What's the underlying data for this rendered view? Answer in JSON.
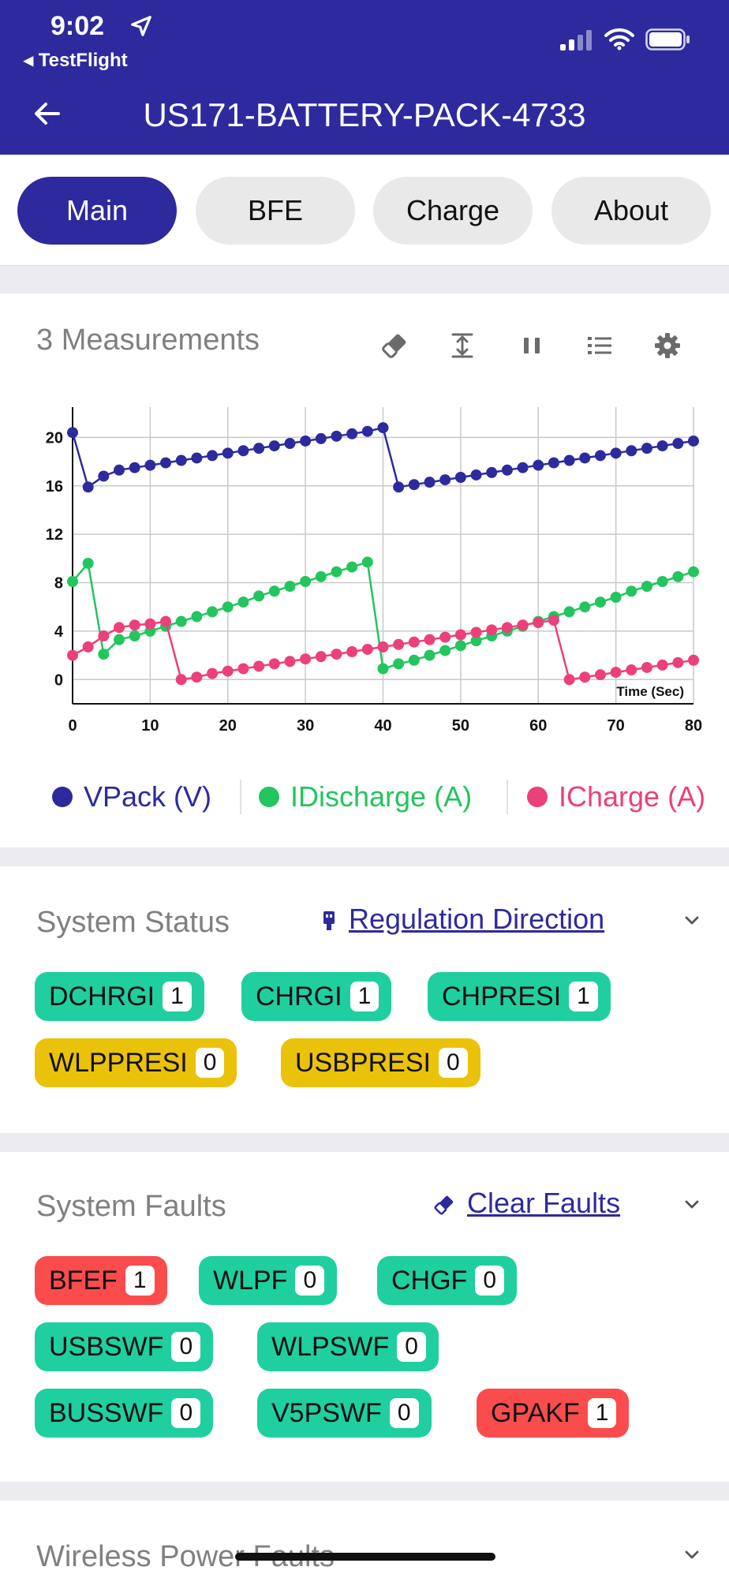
{
  "status_bar": {
    "time": "9:02",
    "back_app": "TestFlight"
  },
  "nav": {
    "title": "US171-BATTERY-PACK-4733"
  },
  "tabs": [
    {
      "label": "Main",
      "active": true
    },
    {
      "label": "BFE",
      "active": false
    },
    {
      "label": "Charge",
      "active": false
    },
    {
      "label": "About",
      "active": false
    }
  ],
  "measurements": {
    "title": "3 Measurements",
    "toolbar_icons": [
      "eraser-icon",
      "fit-height-icon",
      "pause-icon",
      "list-icon",
      "gear-icon"
    ]
  },
  "chart_data": {
    "type": "line",
    "xlabel": "Time (Sec)",
    "ylabel": "",
    "xlim": [
      0,
      80
    ],
    "ylim": [
      -2,
      22.5
    ],
    "x_ticks": [
      0,
      10,
      20,
      30,
      40,
      50,
      60,
      70,
      80
    ],
    "y_ticks": [
      0,
      4,
      8,
      12,
      16,
      20
    ],
    "grid": true,
    "legend_position": "bottom",
    "series": [
      {
        "name": "VPack (V)",
        "color": "#2d2a9e",
        "x": [
          0,
          2,
          4,
          6,
          8,
          10,
          12,
          14,
          16,
          18,
          20,
          22,
          24,
          26,
          28,
          30,
          32,
          34,
          36,
          38,
          40,
          42,
          44,
          46,
          48,
          50,
          52,
          54,
          56,
          58,
          60,
          62,
          64,
          66,
          68,
          70,
          72,
          74,
          76,
          78,
          80
        ],
        "y": [
          20.4,
          15.9,
          16.8,
          17.3,
          17.5,
          17.7,
          17.9,
          18.1,
          18.3,
          18.5,
          18.7,
          18.9,
          19.1,
          19.3,
          19.5,
          19.7,
          19.9,
          20.1,
          20.3,
          20.5,
          20.8,
          15.9,
          16.1,
          16.3,
          16.5,
          16.7,
          16.9,
          17.1,
          17.3,
          17.5,
          17.7,
          17.9,
          18.1,
          18.3,
          18.5,
          18.7,
          18.9,
          19.1,
          19.3,
          19.5,
          19.7
        ]
      },
      {
        "name": "IDischarge (A)",
        "color": "#22c55e",
        "x": [
          0,
          2,
          4,
          6,
          8,
          10,
          12,
          14,
          16,
          18,
          20,
          22,
          24,
          26,
          28,
          30,
          32,
          34,
          36,
          38,
          40,
          42,
          44,
          46,
          48,
          50,
          52,
          54,
          56,
          58,
          60,
          62,
          64,
          66,
          68,
          70,
          72,
          74,
          76,
          78,
          80
        ],
        "y": [
          8.1,
          9.6,
          2.1,
          3.3,
          3.6,
          4.0,
          4.4,
          4.8,
          5.2,
          5.6,
          6.0,
          6.4,
          6.9,
          7.3,
          7.7,
          8.1,
          8.5,
          8.9,
          9.3,
          9.7,
          0.9,
          1.3,
          1.6,
          2.0,
          2.4,
          2.8,
          3.2,
          3.6,
          4.0,
          4.4,
          4.8,
          5.2,
          5.6,
          6.0,
          6.4,
          6.8,
          7.3,
          7.7,
          8.1,
          8.5,
          8.9
        ]
      },
      {
        "name": "ICharge (A)",
        "color": "#ec407a",
        "x": [
          0,
          2,
          4,
          6,
          8,
          10,
          12,
          14,
          16,
          18,
          20,
          22,
          24,
          26,
          28,
          30,
          32,
          34,
          36,
          38,
          40,
          42,
          44,
          46,
          48,
          50,
          52,
          54,
          56,
          58,
          60,
          62,
          64,
          66,
          68,
          70,
          72,
          74,
          76,
          78,
          80
        ],
        "y": [
          2.0,
          2.7,
          3.6,
          4.3,
          4.5,
          4.6,
          4.8,
          0.0,
          0.2,
          0.5,
          0.7,
          0.9,
          1.1,
          1.3,
          1.5,
          1.7,
          1.9,
          2.1,
          2.3,
          2.5,
          2.7,
          2.9,
          3.1,
          3.3,
          3.5,
          3.7,
          3.9,
          4.1,
          4.3,
          4.5,
          4.7,
          4.9,
          0.0,
          0.2,
          0.4,
          0.6,
          0.8,
          1.0,
          1.2,
          1.4,
          1.6
        ]
      }
    ]
  },
  "system_status": {
    "title": "System Status",
    "link_label": "Regulation Direction",
    "chips": [
      {
        "label": "DCHRGI",
        "value": "1",
        "color": "green"
      },
      {
        "label": "CHRGI",
        "value": "1",
        "color": "green"
      },
      {
        "label": "CHPRESI",
        "value": "1",
        "color": "green"
      },
      {
        "label": "WLPPRESI",
        "value": "0",
        "color": "yellow"
      },
      {
        "label": "USBPRESI",
        "value": "0",
        "color": "yellow"
      }
    ]
  },
  "system_faults": {
    "title": "System Faults",
    "link_label": "Clear Faults",
    "chips": [
      {
        "label": "BFEF",
        "value": "1",
        "color": "red"
      },
      {
        "label": "WLPF",
        "value": "0",
        "color": "green"
      },
      {
        "label": "CHGF",
        "value": "0",
        "color": "green"
      },
      {
        "label": "USBSWF",
        "value": "0",
        "color": "green"
      },
      {
        "label": "WLPSWF",
        "value": "0",
        "color": "green"
      },
      {
        "label": "BUSSWF",
        "value": "0",
        "color": "green"
      },
      {
        "label": "V5PSWF",
        "value": "0",
        "color": "green"
      },
      {
        "label": "GPAKF",
        "value": "1",
        "color": "red"
      }
    ]
  },
  "wireless_power_faults": {
    "title": "Wireless Power Faults"
  }
}
